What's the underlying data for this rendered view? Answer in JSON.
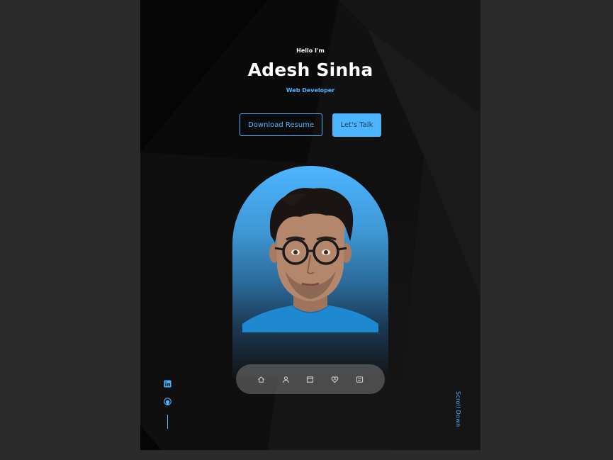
{
  "header": {
    "greeting": "Hello I'm",
    "name": "Adesh Sinha",
    "role": "Web Developer"
  },
  "cta": {
    "download_label": "Download Resume",
    "talk_label": "Let's Talk"
  },
  "nav": {
    "items": [
      {
        "icon": "home-icon"
      },
      {
        "icon": "user-icon"
      },
      {
        "icon": "book-icon"
      },
      {
        "icon": "services-icon"
      },
      {
        "icon": "message-icon"
      }
    ]
  },
  "socials": [
    {
      "icon": "linkedin-icon"
    },
    {
      "icon": "github-icon"
    }
  ],
  "scroll": {
    "label": "Scroll Down"
  },
  "colors": {
    "accent": "#4db5ff",
    "background": "#121212",
    "outer": "#2b2b2b"
  }
}
